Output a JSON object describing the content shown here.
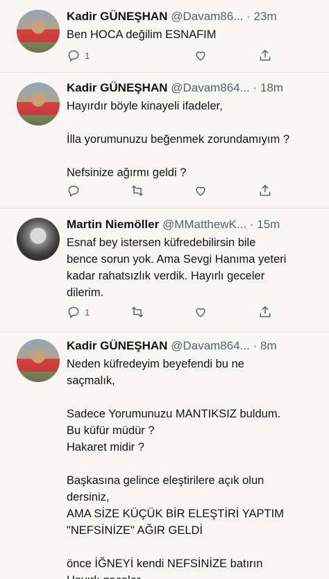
{
  "tweets": [
    {
      "author_name": "Kadir GÜNEŞHAN",
      "handle": "@Davam86...",
      "separator": "·",
      "time": "23m",
      "lines": [
        "Ben HOCA değilim ESNAFIM"
      ],
      "reply_count": "1",
      "avatar": "child-photo"
    },
    {
      "author_name": "Kadir GÜNEŞHAN",
      "handle": "@Davam864...",
      "separator": "·",
      "time": "18m",
      "lines": [
        "Hayırdır böyle kinayeli ifadeler,",
        "",
        "İlla yorumunuzu beğenmek zorundamıyım  ?",
        "",
        "Nefsinize ağırmı geldi  ?"
      ],
      "reply_count": "",
      "avatar": "child-photo"
    },
    {
      "author_name": "Martin Niemöller",
      "handle": "@MMatthewK...",
      "separator": "·",
      "time": "15m",
      "lines": [
        "Esnaf bey istersen küfredebilirsin bile",
        "bence sorun yok. Ama Sevgi Hanıma yeteri",
        "kadar rahatsızlık verdik. Hayırlı geceler",
        "dilerim."
      ],
      "reply_count": "1",
      "avatar": "man-portrait"
    },
    {
      "author_name": "Kadir GÜNEŞHAN",
      "handle": "@Davam864...",
      "separator": "·",
      "time": "8m",
      "lines": [
        "Neden küfredeyim beyefendi bu ne",
        "saçmalık,",
        "",
        "Sadece Yorumunuzu MANTIKSIZ buldum.",
        "Bu küfür müdür  ?",
        "Hakaret midir ?",
        "",
        "Başkasına gelince eleştirilere açık olun",
        "dersiniz,",
        "AMA SİZE KÜÇÜK BİR ELEŞTİRİ YAPTIM",
        "\"NEFSİNİZE\" AĞIR GELDİ",
        "",
        "önce İĞNEYİ kendi NEFSİNİZE batırın",
        "Hayırlı geceler"
      ],
      "reply_count": "",
      "avatar": "child-photo"
    }
  ],
  "icons": {
    "reply": "reply-icon",
    "retweet": "retweet-icon",
    "like": "heart-icon",
    "share": "share-icon"
  },
  "colors": {
    "background": "#f7f6f3",
    "text": "#0f1419",
    "secondary": "#536471",
    "divider": "#e3e3e0"
  }
}
